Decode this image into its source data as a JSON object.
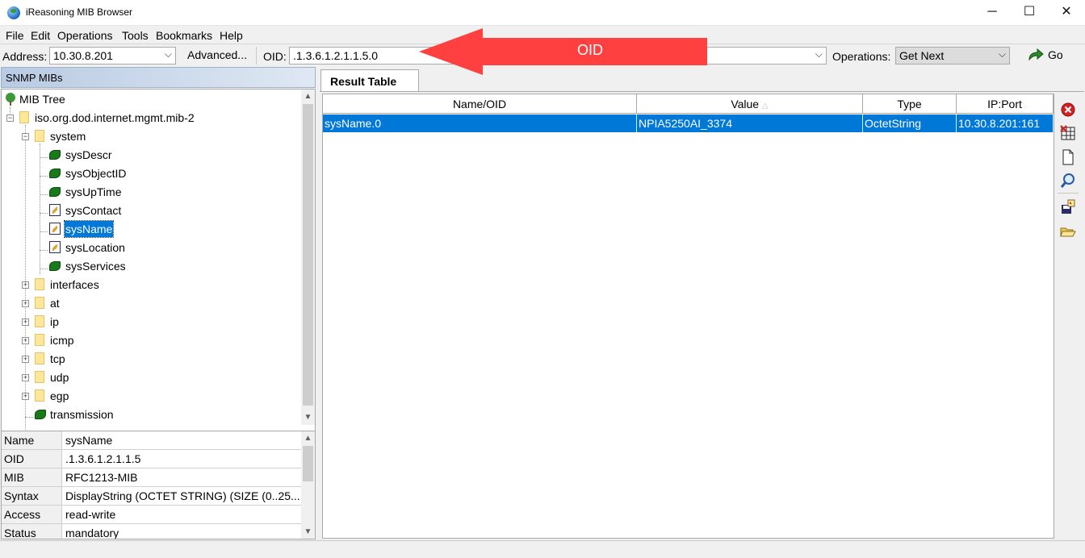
{
  "window": {
    "title": "iReasoning MIB Browser",
    "controls": {
      "minimize": "─",
      "maximize": "☐",
      "close": "✕"
    }
  },
  "menu": [
    "File",
    "Edit",
    "Operations",
    "Tools",
    "Bookmarks",
    "Help"
  ],
  "toolbar": {
    "address_label": "Address:",
    "address_value": "10.30.8.201",
    "advanced_label": "Advanced...",
    "oid_label": "OID:",
    "oid_value": ".1.3.6.1.2.1.1.5.0",
    "operations_label": "Operations:",
    "operation_value": "Get Next",
    "go_label": "Go"
  },
  "annotation": {
    "label": "OID",
    "color": "#ff4040"
  },
  "left_panel": {
    "header": "SNMP MIBs",
    "tree": {
      "root": "MIB Tree",
      "mib2": "iso.org.dod.internet.mgmt.mib-2",
      "system": "system",
      "system_children": [
        "sysDescr",
        "sysObjectID",
        "sysUpTime",
        "sysContact",
        "sysName",
        "sysLocation",
        "sysServices"
      ],
      "groups": [
        "interfaces",
        "at",
        "ip",
        "icmp",
        "tcp",
        "udp",
        "egp"
      ],
      "transmission": "transmission",
      "selected": "sysName"
    },
    "properties": [
      {
        "key": "Name",
        "value": "sysName"
      },
      {
        "key": "OID",
        "value": ".1.3.6.1.2.1.1.5"
      },
      {
        "key": "MIB",
        "value": "RFC1213-MIB"
      },
      {
        "key": "Syntax",
        "value": "DisplayString (OCTET STRING) (SIZE (0..25..."
      },
      {
        "key": "Access",
        "value": "read-write"
      },
      {
        "key": "Status",
        "value": "mandatory"
      }
    ]
  },
  "result": {
    "tab_label": "Result Table",
    "columns": [
      "Name/OID",
      "Value",
      "Type",
      "IP:Port"
    ],
    "sort_indicator": "△",
    "rows": [
      {
        "name": "sysName.0",
        "value": "NPIA5250AI_3374",
        "type": "OctetString",
        "ipport": "10.30.8.201:161"
      }
    ]
  },
  "colors": {
    "selection": "#0078d7",
    "go_green": "#2a8a2a",
    "delete_red": "#d42020"
  }
}
